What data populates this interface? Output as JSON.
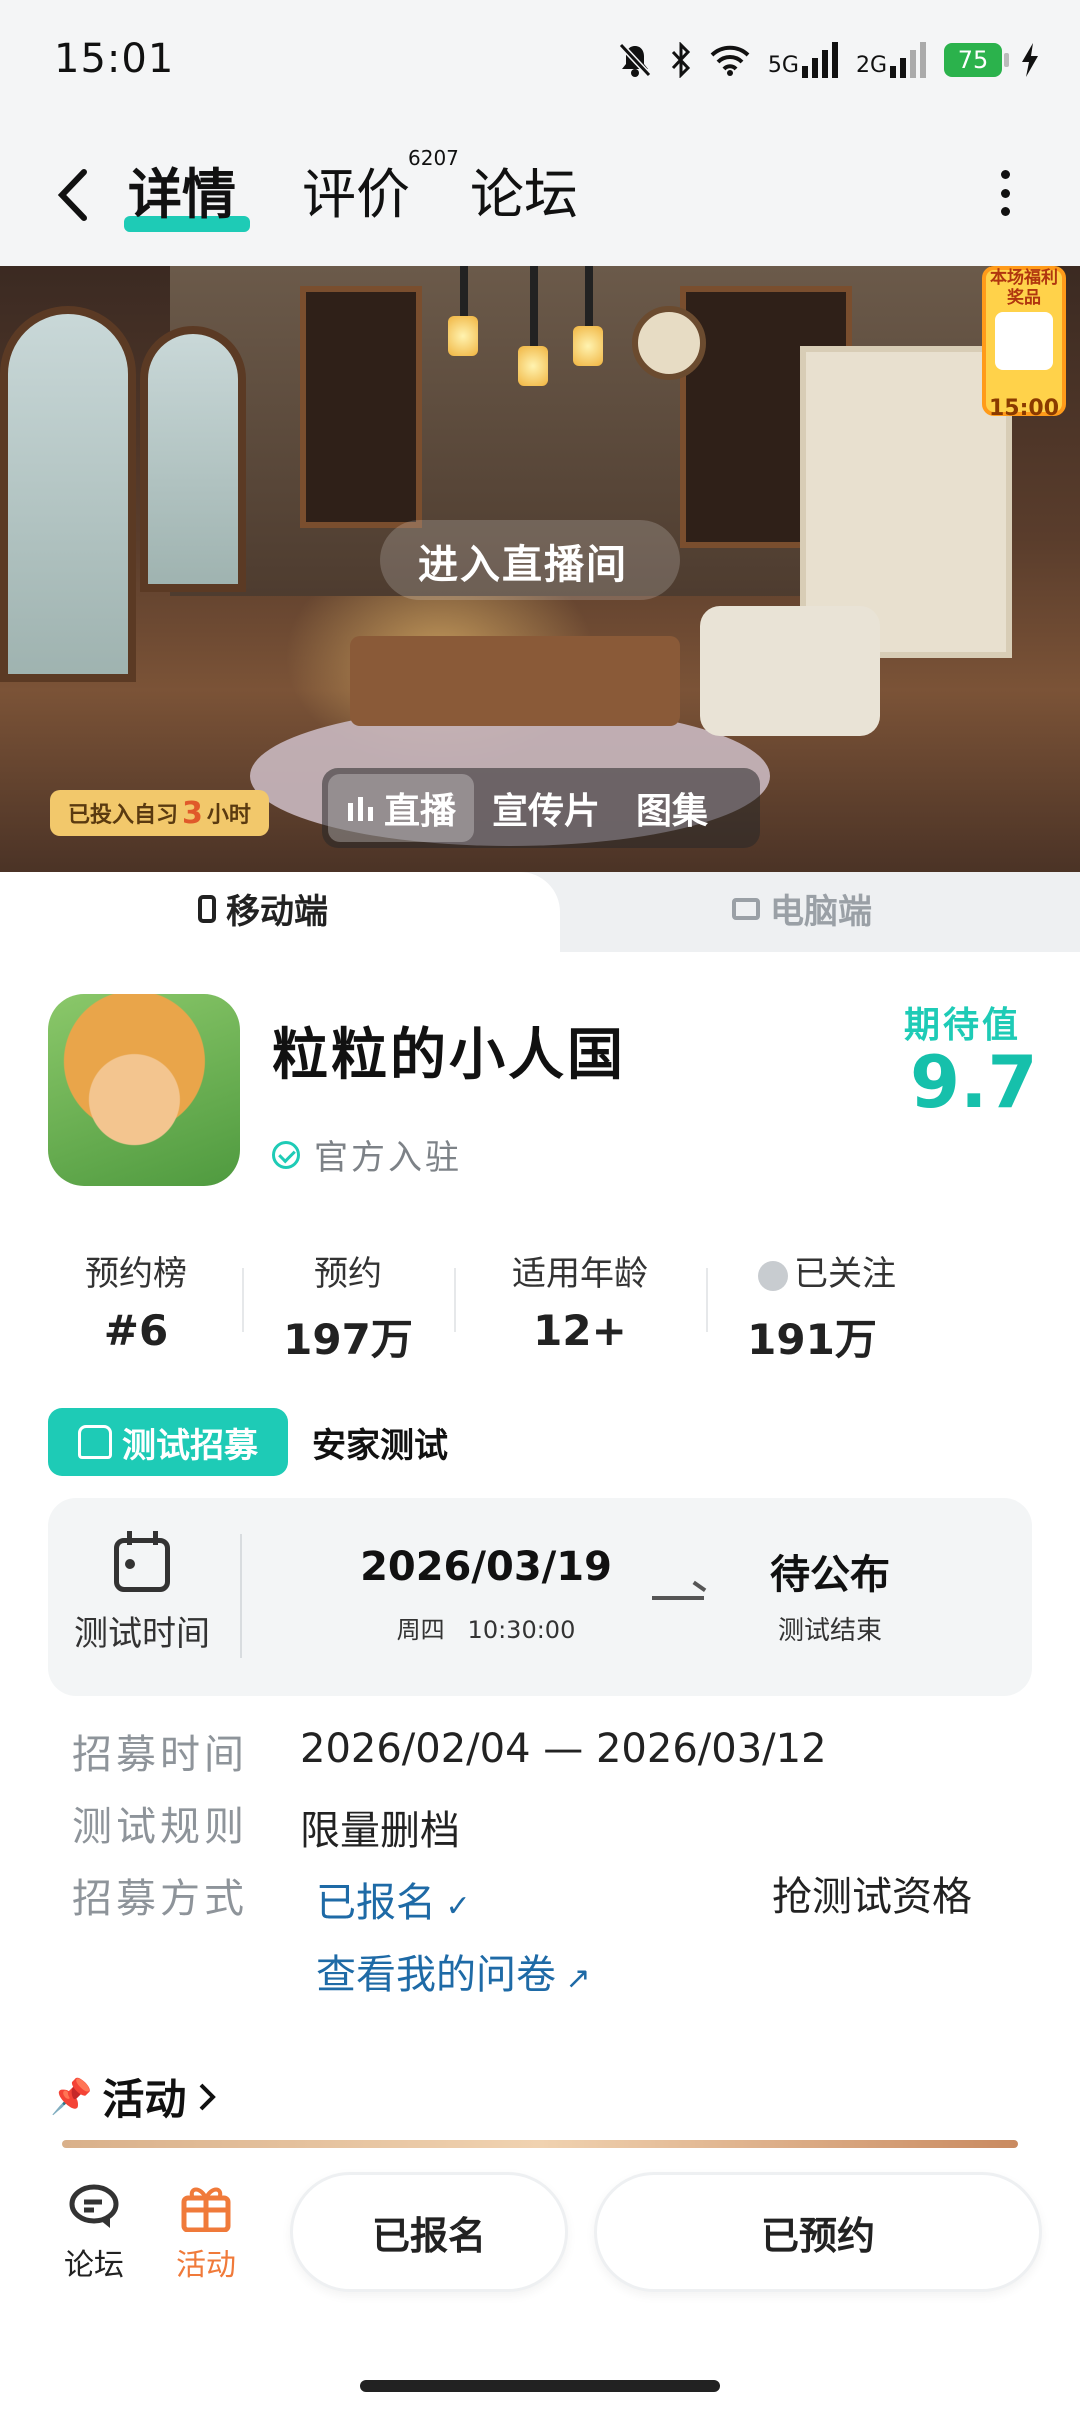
{
  "status_bar": {
    "time": "15:01",
    "signal_1_label": "5G",
    "signal_2_label": "2G",
    "battery": "75"
  },
  "nav": {
    "tabs": [
      {
        "label": "详情",
        "active": true
      },
      {
        "label": "评价",
        "count": "6207"
      },
      {
        "label": "论坛"
      }
    ]
  },
  "hero": {
    "live_room_label": "进入直播间",
    "media_tabs": [
      "直播",
      "宣传片",
      "图集"
    ],
    "self_study_prefix": "已投入自习",
    "self_study_hours": "3",
    "self_study_unit": "小时",
    "prize_title": "本场福利奖品",
    "prize_time": "15:00"
  },
  "device_tabs": {
    "mobile": "移动端",
    "pc": "电脑端"
  },
  "game": {
    "title": "粒粒的小人国",
    "official_label": "官方入驻",
    "expectation_label": "期待值",
    "expectation_value": "9.7"
  },
  "stats": [
    {
      "label": "预约榜",
      "value": "#6"
    },
    {
      "label": "预约",
      "value": "197万"
    },
    {
      "label": "适用年龄",
      "value": "12+"
    },
    {
      "label": "已关注",
      "value": "191万"
    }
  ],
  "recruit": {
    "pill_label": "测试招募",
    "test_name": "安家测试",
    "test_time_label": "测试时间",
    "start_date": "2026/03/19",
    "start_weekday": "周四",
    "start_time": "10:30:00",
    "end_status": "待公布",
    "end_label": "测试结束",
    "rows": {
      "recruit_time_label": "招募时间",
      "recruit_time_value": "2026/02/04 — 2026/03/12",
      "rules_label": "测试规则",
      "rules_value": "限量删档",
      "method_label": "招募方式",
      "signed_up": "已报名",
      "questionnaire": "查看我的问卷",
      "grab_label": "抢测试资格"
    }
  },
  "activity": {
    "title": "活动"
  },
  "bottom_bar": {
    "forum_label": "论坛",
    "activity_label": "活动",
    "signed_button": "已报名",
    "reserved_button": "已预约"
  },
  "colors": {
    "accent": "#1ecbb6",
    "link_blue": "#1e6aa6",
    "activity_orange": "#f07a3a"
  }
}
